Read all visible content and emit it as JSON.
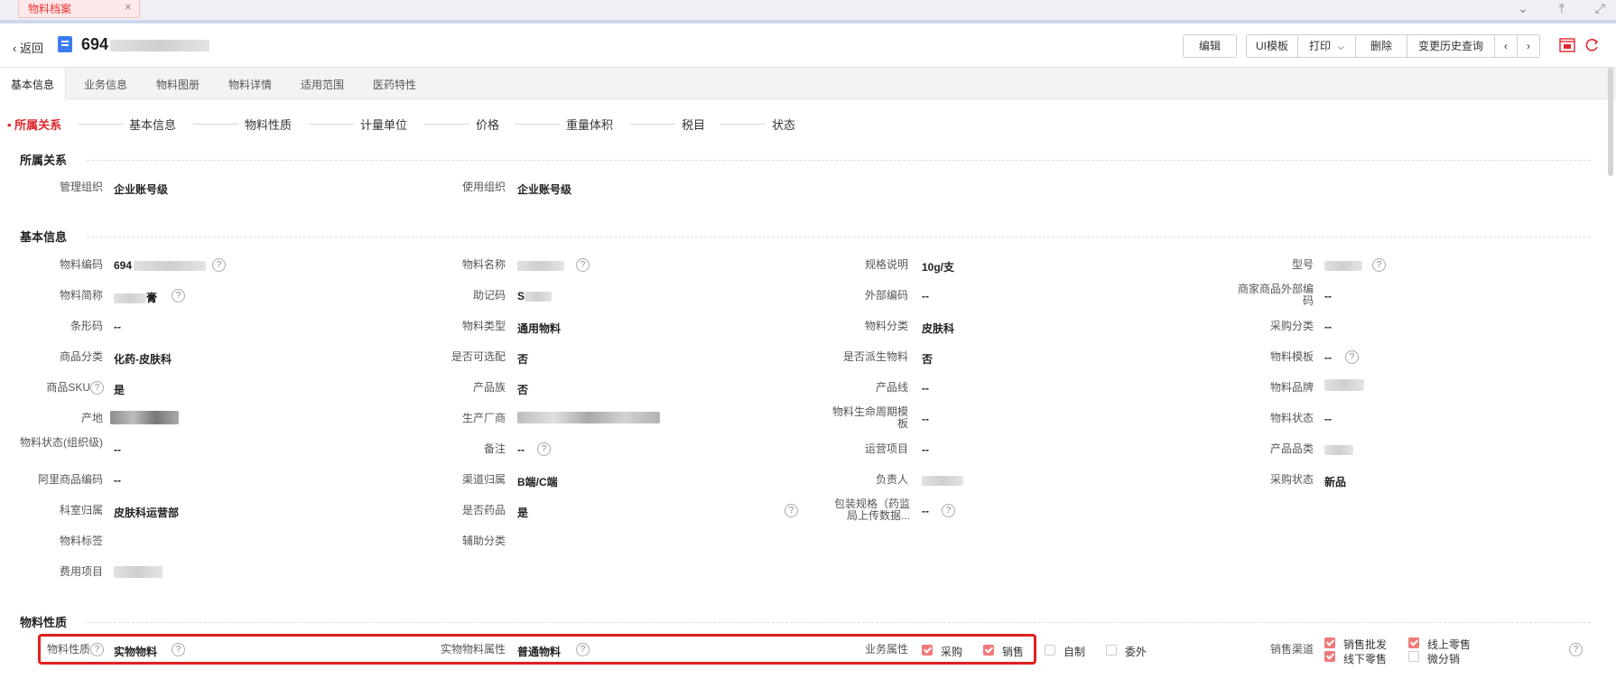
{
  "window_tab": {
    "label": "物料档案"
  },
  "header": {
    "back_label": "返回",
    "title_prefix": "694"
  },
  "toolbar": {
    "edit": "编辑",
    "ui_template": "UI模板",
    "print": "打印",
    "delete": "删除",
    "history": "变更历史查询"
  },
  "tabs": [
    "基本信息",
    "业务信息",
    "物料图册",
    "物料详情",
    "适用范围",
    "医药特性"
  ],
  "steps": [
    "所属关系",
    "基本信息",
    "物料性质",
    "计量单位",
    "价格",
    "重量体积",
    "税目",
    "状态"
  ],
  "sections": {
    "belonging": {
      "title": "所属关系",
      "fields": [
        {
          "label": "管理组织",
          "value": "企业账号级"
        },
        {
          "label": "使用组织",
          "value": "企业账号级"
        }
      ]
    },
    "basic": {
      "title": "基本信息",
      "fields": [
        {
          "label": "物料编码",
          "value": "694"
        },
        {
          "label": "物料名称",
          "value": ""
        },
        {
          "label": "规格说明",
          "value": "10g/支"
        },
        {
          "label": "型号",
          "value": ""
        },
        {
          "label": "物料简称",
          "value": "膏"
        },
        {
          "label": "助记码",
          "value": "S"
        },
        {
          "label": "外部编码",
          "value": "--"
        },
        {
          "label": "商家商品外部编码",
          "value": "--"
        },
        {
          "label": "条形码",
          "value": "--"
        },
        {
          "label": "物料类型",
          "value": "通用物料"
        },
        {
          "label": "物料分类",
          "value": "皮肤科"
        },
        {
          "label": "采购分类",
          "value": "--"
        },
        {
          "label": "商品分类",
          "value": "化药-皮肤科"
        },
        {
          "label": "是否可选配",
          "value": "否"
        },
        {
          "label": "是否派生物料",
          "value": "否"
        },
        {
          "label": "物料模板",
          "value": "--"
        },
        {
          "label": "商品SKU",
          "value": "是"
        },
        {
          "label": "产品族",
          "value": "否"
        },
        {
          "label": "产品线",
          "value": "--"
        },
        {
          "label": "物料品牌",
          "value": ""
        },
        {
          "label": "产地",
          "value": ""
        },
        {
          "label": "生产厂商",
          "value": ""
        },
        {
          "label": "物料生命周期模板",
          "value": "--"
        },
        {
          "label": "物料状态",
          "value": "--"
        },
        {
          "label": "物料状态(组织级)",
          "value": "--"
        },
        {
          "label": "备注",
          "value": "--"
        },
        {
          "label": "运营项目",
          "value": "--"
        },
        {
          "label": "产品品类",
          "value": ""
        },
        {
          "label": "阿里商品编码",
          "value": "--"
        },
        {
          "label": "渠道归属",
          "value": "B端/C端"
        },
        {
          "label": "负责人",
          "value": ""
        },
        {
          "label": "采购状态",
          "value": "新品"
        },
        {
          "label": "科室归属",
          "value": "皮肤科运营部"
        },
        {
          "label": "是否药品",
          "value": "是"
        },
        {
          "label": "包装规格（药监局上传数据...",
          "value": "--"
        },
        {
          "label": "物料标签",
          "value": ""
        },
        {
          "label": "辅助分类",
          "value": ""
        },
        {
          "label": "费用项目",
          "value": ""
        }
      ]
    },
    "nature": {
      "title": "物料性质",
      "material_nature": {
        "label": "物料性质",
        "value": "实物物料"
      },
      "physical_attr": {
        "label": "实物物料属性",
        "value": "普通物料"
      },
      "business": {
        "label": "业务属性",
        "options": [
          {
            "label": "采购",
            "checked": true
          },
          {
            "label": "销售",
            "checked": true
          },
          {
            "label": "自制",
            "checked": false
          },
          {
            "label": "委外",
            "checked": false
          }
        ]
      },
      "channel": {
        "label": "销售渠道",
        "options": [
          {
            "label": "销售批发",
            "checked": true
          },
          {
            "label": "线上零售",
            "checked": true
          },
          {
            "label": "线下零售",
            "checked": true
          },
          {
            "label": "微分销",
            "checked": false
          }
        ]
      }
    }
  }
}
